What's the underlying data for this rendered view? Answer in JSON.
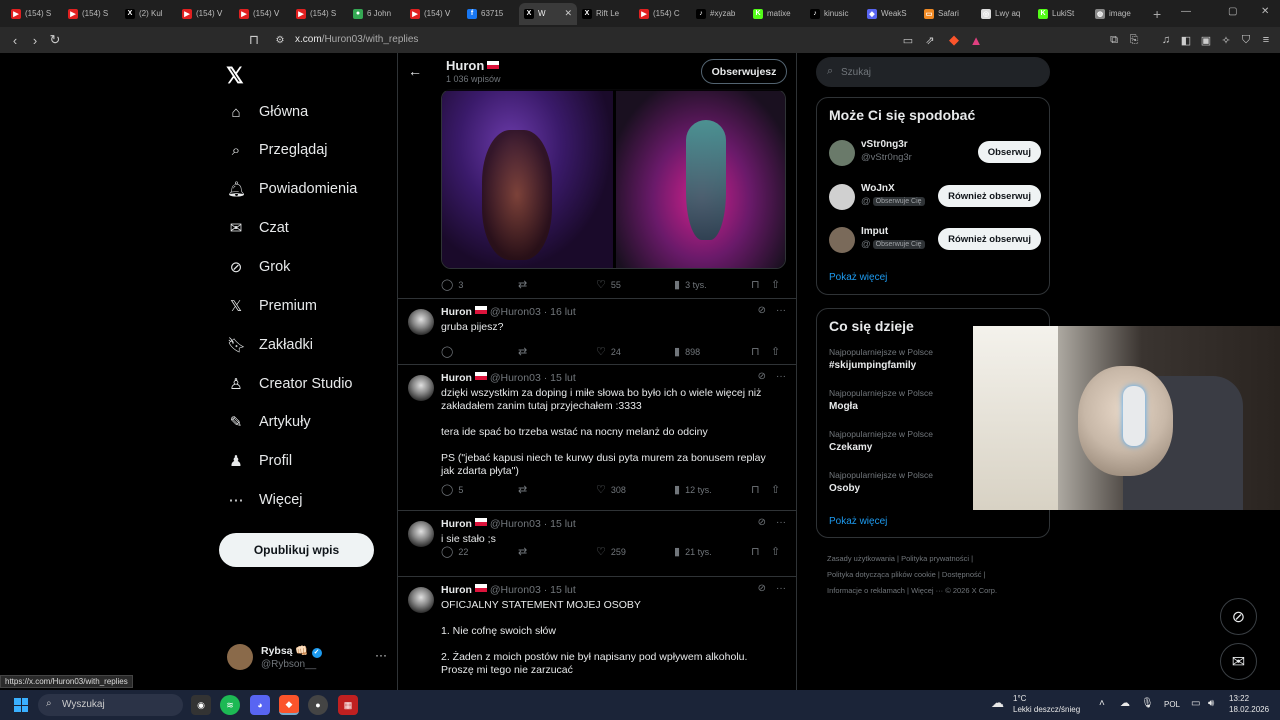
{
  "browser": {
    "tabs": [
      {
        "label": "(154) S",
        "color": "#e02020",
        "glyph": "▶"
      },
      {
        "label": "(154) S",
        "color": "#e02020",
        "glyph": "▶"
      },
      {
        "label": "(2) Kul",
        "color": "#000000",
        "glyph": "X"
      },
      {
        "label": "(154) ᐯ",
        "color": "#e02020",
        "glyph": "▶"
      },
      {
        "label": "(154) ᐯ",
        "color": "#e02020",
        "glyph": "▶"
      },
      {
        "label": "(154) S",
        "color": "#e02020",
        "glyph": "▶"
      },
      {
        "label": "6 John",
        "color": "#34a853",
        "glyph": "●"
      },
      {
        "label": "(154) ᐯ",
        "color": "#e02020",
        "glyph": "▶"
      },
      {
        "label": "63715",
        "color": "#1877f2",
        "glyph": "f"
      },
      {
        "label": "W",
        "color": "#000000",
        "glyph": "X",
        "active": true
      },
      {
        "label": "Rift Le",
        "color": "#000000",
        "glyph": "X"
      },
      {
        "label": "(154) C",
        "color": "#e02020",
        "glyph": "▶"
      },
      {
        "label": "#xyzab",
        "color": "#000000",
        "glyph": "♪"
      },
      {
        "label": "matixe",
        "color": "#53fc18",
        "glyph": "K"
      },
      {
        "label": "kinusic",
        "color": "#000000",
        "glyph": "♪"
      },
      {
        "label": "WeakS",
        "color": "#5865f2",
        "glyph": "◆"
      },
      {
        "label": "Safari",
        "color": "#f08a24",
        "glyph": "▭"
      },
      {
        "label": "Lwy aq",
        "color": "#dddddd",
        "glyph": "◎"
      },
      {
        "label": "LukiSt",
        "color": "#53fc18",
        "glyph": "K"
      },
      {
        "label": "image",
        "color": "#888888",
        "glyph": "◍"
      }
    ],
    "url_host": "x.com",
    "url_path": "/Huron03/with_replies",
    "status_url": "https://x.com/Huron03/with_replies"
  },
  "nav": {
    "logo": "𝕏",
    "items": [
      {
        "label": "Główna",
        "icon": "⌂"
      },
      {
        "label": "Przeglądaj",
        "icon": "⌕"
      },
      {
        "label": "Powiadomienia",
        "icon": "🔔︎"
      },
      {
        "label": "Czat",
        "icon": "✉"
      },
      {
        "label": "Grok",
        "icon": "⊘"
      },
      {
        "label": "Premium",
        "icon": "𝕏"
      },
      {
        "label": "Zakładki",
        "icon": "🔖︎"
      },
      {
        "label": "Creator Studio",
        "icon": "♙"
      },
      {
        "label": "Artykuły",
        "icon": "✎"
      },
      {
        "label": "Profil",
        "icon": "♟"
      },
      {
        "label": "Więcej",
        "icon": "⋯"
      }
    ],
    "publish_label": "Opublikuj wpis",
    "account": {
      "name": "Rybsą 👊🏻",
      "handle": "@Rybson__",
      "more": "···"
    }
  },
  "profile": {
    "name": "Huron",
    "post_count": "1 036 wpisów",
    "follow_label": "Obserwujesz"
  },
  "media_actions": {
    "replies": "3",
    "reposts": "",
    "likes": "55",
    "views": "3 tys."
  },
  "tweets": [
    {
      "name": "Huron",
      "handle": "@Huron03 · 16 lut",
      "body": "gruba pijesz?",
      "replies": "",
      "likes": "24",
      "views": "898"
    },
    {
      "name": "Huron",
      "handle": "@Huron03 · 15 lut",
      "body": "dzięki wszystkim za doping i miłe słowa bo było ich o wiele więcej niż zakładałem zanim tutaj przyjechałem :3333\n\ntera ide spać bo trzeba wstać na nocny melanż do odciny\n\nPS (\"jebać kapusi niech te kurwy dusi pyta murem za bonusem replay jak zdarta płyta\")",
      "replies": "5",
      "likes": "308",
      "views": "12 tys."
    },
    {
      "name": "Huron",
      "handle": "@Huron03 · 15 lut",
      "body": "i sie stało ;s",
      "replies": "22",
      "likes": "259",
      "views": "21 tys."
    },
    {
      "name": "Huron",
      "handle": "@Huron03 · 15 lut",
      "body": "OFICJALNY STATEMENT MOJEJ OSOBY\n\n1. Nie cofnę swoich słów\n\n2. Żaden z moich postów nie był napisany pod wpływem alkoholu. Proszę mi tego nie zarzucać",
      "replies": "",
      "likes": "",
      "views": ""
    }
  ],
  "search": {
    "placeholder": "Szukaj"
  },
  "suggestions": {
    "title": "Może Ci się spodobać",
    "items": [
      {
        "name": "vStr0ng3r",
        "handle": "@vStr0ng3r",
        "chip": "",
        "button": "Obserwuj"
      },
      {
        "name": "WoJnX",
        "handle": "@",
        "chip": "Obserwuje Cię",
        "button": "Również obserwuj"
      },
      {
        "name": "Imput",
        "handle": "@",
        "chip": "Obserwuje Cię",
        "button": "Również obserwuj"
      }
    ],
    "show_more": "Pokaż więcej"
  },
  "trends": {
    "title": "Co się dzieje",
    "items": [
      {
        "context": "Najpopularniejsze w Polsce",
        "name": "#skijumpingfamily"
      },
      {
        "context": "Najpopularniejsze w Polsce",
        "name": "Mogła"
      },
      {
        "context": "Najpopularniejsze w Polsce",
        "name": "Czekamy"
      },
      {
        "context": "Najpopularniejsze w Polsce",
        "name": "Osoby"
      }
    ],
    "show_more": "Pokaż więcej"
  },
  "footer": {
    "line1": "Zasady użytkowania  |  Polityka prywatności  |",
    "line2": "Polityka dotycząca plików cookie  |  Dostępność  |",
    "line3": "Informacje o reklamach  |  Więcej ···  © 2026 X Corp."
  },
  "taskbar": {
    "search_label": "Wyszukaj",
    "weather_temp": "1°C",
    "weather_desc": "Lekki deszcz/śnieg",
    "lang": "POL",
    "time": "13:22",
    "date": "18.02.2026"
  }
}
